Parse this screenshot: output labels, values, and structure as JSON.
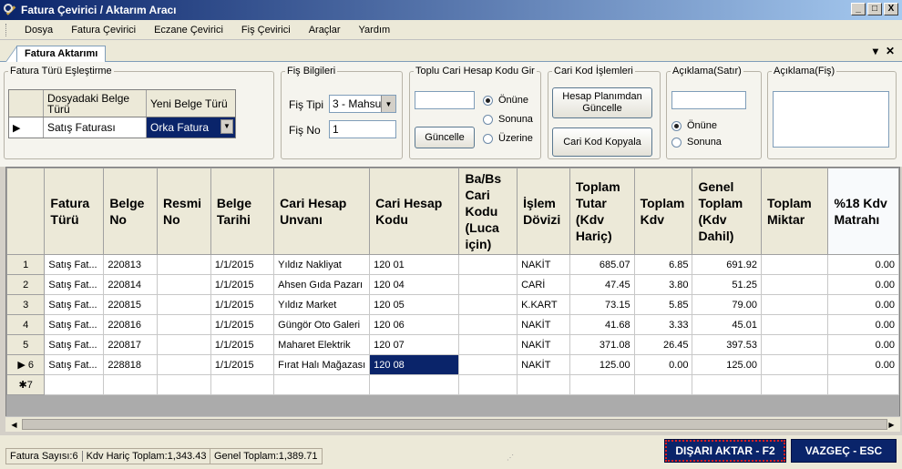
{
  "window": {
    "title": "Fatura Çevirici / Aktarım Aracı",
    "min": "_",
    "max": "□",
    "close": "X"
  },
  "menu": [
    "Dosya",
    "Fatura Çevirici",
    "Eczane Çevirici",
    "Fiş Çevirici",
    "Araçlar",
    "Yardım"
  ],
  "tab": {
    "label": "Fatura Aktarımı",
    "pin": "▾",
    "close": "✕"
  },
  "fatura_turu": {
    "legend": "Fatura Türü Eşleştirme",
    "col1": "Dosyadaki Belge Türü",
    "col2": "Yeni Belge Türü",
    "row_marker": "▶",
    "source": "Satış Faturası",
    "target": "Orka Fatura"
  },
  "fis_bilgileri": {
    "legend": "Fiş Bilgileri",
    "tipi_label": "Fiş Tipi",
    "tipi_value": "3 - Mahsu",
    "no_label": "Fiş No",
    "no_value": "1"
  },
  "toplu_cari": {
    "legend": "Toplu Cari Hesap Kodu Gir",
    "input": "",
    "button": "Güncelle",
    "opt1": "Önüne",
    "opt2": "Sonuna",
    "opt3": "Üzerine"
  },
  "cari_kod": {
    "legend": "Cari Kod İşlemleri",
    "btn1": "Hesap Planımdan Güncelle",
    "btn2": "Cari Kod Kopyala"
  },
  "aciklama_satir": {
    "legend": "Açıklama(Satır)",
    "input": "",
    "opt1": "Önüne",
    "opt2": "Sonuna"
  },
  "aciklama_fis": {
    "legend": "Açıklama(Fiş)",
    "input": ""
  },
  "grid": {
    "headers": [
      "Fatura Türü",
      "Belge No",
      "Resmi No",
      "Belge Tarihi",
      "Cari Hesap Unvanı",
      "Cari Hesap Kodu",
      "Ba/Bs Cari Kodu (Luca için)",
      "İşlem Dövizi",
      "Toplam Tutar (Kdv Hariç)",
      "Toplam Kdv",
      "Genel Toplam (Kdv Dahil)",
      "Toplam Miktar",
      "%18 Kdv Matrahı"
    ],
    "rows": [
      {
        "n": "1",
        "c": [
          "Satış Fat...",
          "220813",
          "",
          "1/1/2015",
          "Yıldız Nakliyat",
          "120 01",
          "",
          "NAKİT",
          "685.07",
          "6.85",
          "691.92",
          "",
          "0.00"
        ]
      },
      {
        "n": "2",
        "c": [
          "Satış Fat...",
          "220814",
          "",
          "1/1/2015",
          "Ahsen Gıda Pazarı",
          "120 04",
          "",
          "CARİ",
          "47.45",
          "3.80",
          "51.25",
          "",
          "0.00"
        ]
      },
      {
        "n": "3",
        "c": [
          "Satış Fat...",
          "220815",
          "",
          "1/1/2015",
          "Yıldız Market",
          "120 05",
          "",
          "K.KART",
          "73.15",
          "5.85",
          "79.00",
          "",
          "0.00"
        ]
      },
      {
        "n": "4",
        "c": [
          "Satış Fat...",
          "220816",
          "",
          "1/1/2015",
          "Güngör Oto Galeri",
          "120 06",
          "",
          "NAKİT",
          "41.68",
          "3.33",
          "45.01",
          "",
          "0.00"
        ]
      },
      {
        "n": "5",
        "c": [
          "Satış Fat...",
          "220817",
          "",
          "1/1/2015",
          "Maharet Elektrik",
          "120 07",
          "",
          "NAKİT",
          "371.08",
          "26.45",
          "397.53",
          "",
          "0.00"
        ]
      },
      {
        "n": "▶ 6",
        "c": [
          "Satış Fat...",
          "228818",
          "",
          "1/1/2015",
          "Fırat Halı Mağazası",
          "120 08",
          "",
          "NAKİT",
          "125.00",
          "0.00",
          "125.00",
          "",
          "0.00"
        ]
      }
    ],
    "new_row": "✱7"
  },
  "status": {
    "count": "Fatura Sayısı:6",
    "kdv_haric": "Kdv Hariç Toplam:1,343.43",
    "genel": "Genel Toplam:1,389.71"
  },
  "actions": {
    "export": "DIŞARI AKTAR - F2",
    "cancel": "VAZGEÇ - ESC"
  }
}
